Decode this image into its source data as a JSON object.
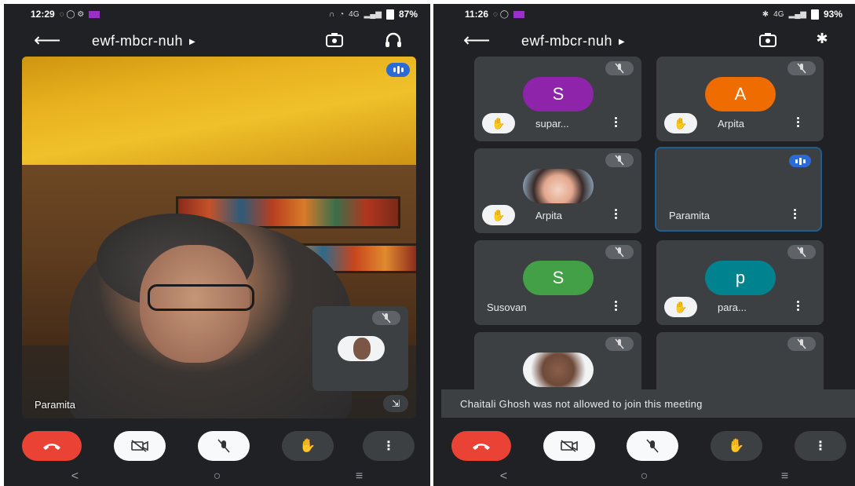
{
  "left_screen": {
    "status": {
      "time": "12:29",
      "battery": "87%",
      "network": "4G"
    },
    "meeting_code": "ewf-mbcr-nuh",
    "speaker_name": "Paramita",
    "toolbar_icons": [
      "back-arrow-icon",
      "camera-switch-icon",
      "headphones-icon"
    ],
    "controls": [
      "end-call-button",
      "camera-off-button",
      "mic-off-button",
      "raise-hand-button",
      "more-options-button"
    ]
  },
  "right_screen": {
    "status": {
      "time": "11:26",
      "battery": "93%",
      "network": "4G"
    },
    "meeting_code": "ewf-mbcr-nuh",
    "participants": [
      {
        "name": "supar...",
        "initial": "S",
        "color": "#8e24aa",
        "hand_raised": true,
        "muted": true
      },
      {
        "name": "Arpita",
        "initial": "A",
        "color": "#ef6c00",
        "hand_raised": true,
        "muted": true
      },
      {
        "name": "Arpita",
        "initial": "",
        "color": "",
        "hand_raised": true,
        "muted": true
      },
      {
        "name": "Paramita",
        "initial": "",
        "color": "",
        "hand_raised": false,
        "muted": false
      },
      {
        "name": "Susovan",
        "initial": "S",
        "color": "#43a047",
        "hand_raised": false,
        "muted": true
      },
      {
        "name": "para...",
        "initial": "p",
        "color": "#00838f",
        "hand_raised": true,
        "muted": true
      },
      {
        "name": "",
        "initial": "",
        "color": "",
        "hand_raised": false,
        "muted": true
      },
      {
        "name": "",
        "initial": "",
        "color": "",
        "hand_raised": false,
        "muted": true
      }
    ],
    "snackbar": "Chaitali Ghosh was not allowed to join this meeting"
  },
  "colors": {
    "end_call": "#ea4335",
    "surface": "#202124",
    "tile": "#3c4043",
    "speaking": "#2c6bd3"
  }
}
